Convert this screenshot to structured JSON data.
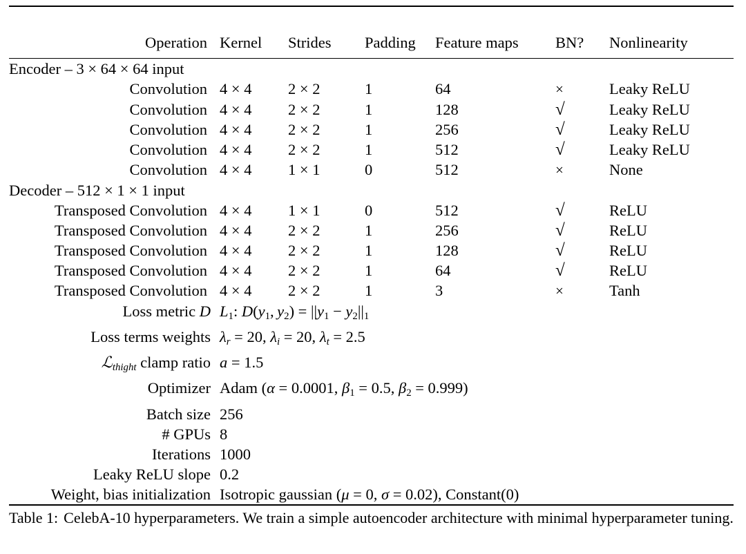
{
  "table": {
    "columns": [
      "Operation",
      "Kernel",
      "Strides",
      "Padding",
      "Feature maps",
      "BN?",
      "Nonlinearity"
    ],
    "sections": [
      {
        "label": "Encoder – 3 × 64 × 64 input",
        "rows": [
          {
            "operation": "Convolution",
            "kernel": "4 × 4",
            "strides": "2 × 2",
            "padding": "1",
            "feature_maps": "64",
            "bn": "×",
            "nonlinearity": "Leaky ReLU"
          },
          {
            "operation": "Convolution",
            "kernel": "4 × 4",
            "strides": "2 × 2",
            "padding": "1",
            "feature_maps": "128",
            "bn": "√",
            "nonlinearity": "Leaky ReLU"
          },
          {
            "operation": "Convolution",
            "kernel": "4 × 4",
            "strides": "2 × 2",
            "padding": "1",
            "feature_maps": "256",
            "bn": "√",
            "nonlinearity": "Leaky ReLU"
          },
          {
            "operation": "Convolution",
            "kernel": "4 × 4",
            "strides": "2 × 2",
            "padding": "1",
            "feature_maps": "512",
            "bn": "√",
            "nonlinearity": "Leaky ReLU"
          },
          {
            "operation": "Convolution",
            "kernel": "4 × 4",
            "strides": "1 × 1",
            "padding": "0",
            "feature_maps": "512",
            "bn": "×",
            "nonlinearity": "None"
          }
        ]
      },
      {
        "label": "Decoder – 512 × 1 × 1 input",
        "rows": [
          {
            "operation": "Transposed Convolution",
            "kernel": "4 × 4",
            "strides": "1 × 1",
            "padding": "0",
            "feature_maps": "512",
            "bn": "√",
            "nonlinearity": "ReLU"
          },
          {
            "operation": "Transposed Convolution",
            "kernel": "4 × 4",
            "strides": "2 × 2",
            "padding": "1",
            "feature_maps": "256",
            "bn": "√",
            "nonlinearity": "ReLU"
          },
          {
            "operation": "Transposed Convolution",
            "kernel": "4 × 4",
            "strides": "2 × 2",
            "padding": "1",
            "feature_maps": "128",
            "bn": "√",
            "nonlinearity": "ReLU"
          },
          {
            "operation": "Transposed Convolution",
            "kernel": "4 × 4",
            "strides": "2 × 2",
            "padding": "1",
            "feature_maps": "64",
            "bn": "√",
            "nonlinearity": "ReLU"
          },
          {
            "operation": "Transposed Convolution",
            "kernel": "4 × 4",
            "strides": "2 × 2",
            "padding": "1",
            "feature_maps": "3",
            "bn": "×",
            "nonlinearity": "Tanh"
          }
        ]
      }
    ],
    "parameters": [
      {
        "label": "Loss metric D",
        "value": "L1: D(y1, y2) = ||y1 − y2||1"
      },
      {
        "label": "Loss terms weights",
        "value": "λr = 20, λi = 20, λt = 2.5"
      },
      {
        "label": "Lthight clamp ratio",
        "value": "a = 1.5"
      },
      {
        "label": "Optimizer",
        "value": "Adam (α = 0.0001, β1 = 0.5, β2 = 0.999)"
      },
      {
        "label": "Batch size",
        "value": "256"
      },
      {
        "label": "# GPUs",
        "value": "8"
      },
      {
        "label": "Iterations",
        "value": "1000"
      },
      {
        "label": "Leaky ReLU slope",
        "value": "0.2"
      },
      {
        "label": "Weight, bias initialization",
        "value": "Isotropic gaussian (μ = 0, σ = 0.02), Constant(0)"
      }
    ]
  },
  "caption": {
    "lead": "Table 1:",
    "text": "CelebA-10 hyperparameters. We train a simple autoencoder architecture with minimal hyperparameter tuning."
  }
}
